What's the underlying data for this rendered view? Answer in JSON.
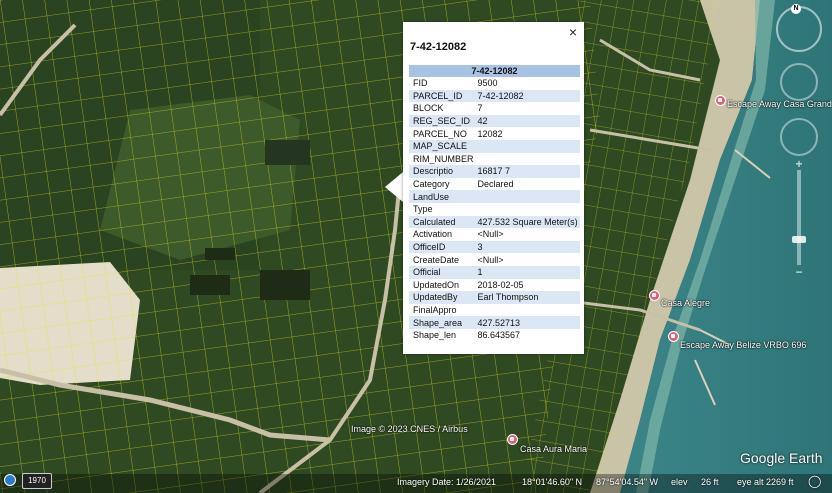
{
  "popup": {
    "close_icon": "×",
    "title": "7-42-12082",
    "table_header": "7-42-12082",
    "attributes": [
      {
        "key": "FID",
        "value": "9500"
      },
      {
        "key": "PARCEL_ID",
        "value": "7-42-12082"
      },
      {
        "key": "BLOCK",
        "value": "7"
      },
      {
        "key": "REG_SEC_ID",
        "value": "42"
      },
      {
        "key": "PARCEL_NO",
        "value": "12082"
      },
      {
        "key": "MAP_SCALE",
        "value": ""
      },
      {
        "key": "RIM_NUMBER",
        "value": ""
      },
      {
        "key": "Descriptio",
        "value": "16817 7"
      },
      {
        "key": "Category",
        "value": "Declared"
      },
      {
        "key": "LandUse",
        "value": ""
      },
      {
        "key": "Type",
        "value": ""
      },
      {
        "key": "Calculated",
        "value": "427.532 Square Meter(s)"
      },
      {
        "key": "Activation",
        "value": "<Null>"
      },
      {
        "key": "OfficeID",
        "value": "3"
      },
      {
        "key": "CreateDate",
        "value": "<Null>"
      },
      {
        "key": "Official",
        "value": "1"
      },
      {
        "key": "UpdatedOn",
        "value": "2018-02-05"
      },
      {
        "key": "UpdatedBy",
        "value": "Earl Thompson"
      },
      {
        "key": "FinalAppro",
        "value": ""
      },
      {
        "key": "Shape_area",
        "value": "427.52713"
      },
      {
        "key": "Shape_len",
        "value": "86.643567"
      }
    ]
  },
  "places": [
    {
      "name": "Escape Away Casa Grand"
    },
    {
      "name": "Casa Alegre"
    },
    {
      "name": "Escape Away Belize VRBO 696"
    },
    {
      "name": "Casa Aura Maria"
    }
  ],
  "map": {
    "credit": "Image © 2023 CNES / Airbus",
    "brand": "Google Earth",
    "compass_label": "N"
  },
  "status": {
    "historical_year": "1970",
    "imagery_date": "Imagery Date: 1/26/2021",
    "lat": "18°01'46.60\" N",
    "lon": "87°54'04.54\" W",
    "elev_label": "elev",
    "elev_value": "26 ft",
    "eye_alt": "eye alt 2269 ft"
  },
  "colors": {
    "forest": "#2f4a22",
    "sand": "#e4ddc9",
    "water": "#3e8a8c",
    "parcel_line": "#e7e41e",
    "table_header": "#a7c3e4",
    "row_alt": "#dce7f5",
    "pin": "#e0607e"
  }
}
